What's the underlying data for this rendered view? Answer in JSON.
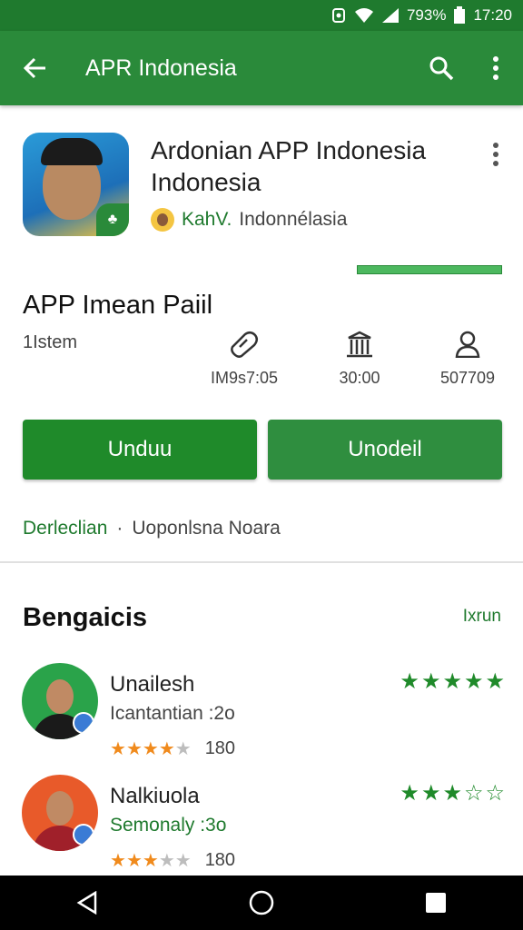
{
  "status_bar": {
    "battery": "793%",
    "time": "17:20"
  },
  "toolbar": {
    "title": "APR Indonesia"
  },
  "app": {
    "name": "Ardonian APP Indonesia Indonesia",
    "developer_name": "KahV.",
    "developer_suffix": "Indonnélasia",
    "install_progress": 1.0
  },
  "info": {
    "section_title": "APP Imean Paiil",
    "size_label": "1Istem",
    "stats": [
      {
        "icon": "tag-icon",
        "value": "IM9s7:05"
      },
      {
        "icon": "building-icon",
        "value": "30:00"
      },
      {
        "icon": "person-icon",
        "value": "507709"
      }
    ]
  },
  "buttons": {
    "primary": "Unduu",
    "secondary": "Unodeil"
  },
  "meta": {
    "link": "Derleclian",
    "separator": "·",
    "text": "Uoponlsna Noara"
  },
  "reviews": {
    "title": "Bengaicis",
    "more_label": "Ixrun",
    "items": [
      {
        "name": "Unailesh",
        "subtitle": "Icantantian :2o",
        "subtitle_green": false,
        "small_rating": 4,
        "count": "180",
        "big_rating": 4.5
      },
      {
        "name": "Nalkiuola",
        "subtitle": "Semonaly :3o",
        "subtitle_green": true,
        "small_rating": 2.5,
        "count": "180",
        "big_rating": 3
      }
    ]
  },
  "colors": {
    "primary": "#2a8a3a",
    "status_bar": "#1f7a2e",
    "button": "#1f8a2a",
    "star_orange": "#f08a1c"
  }
}
